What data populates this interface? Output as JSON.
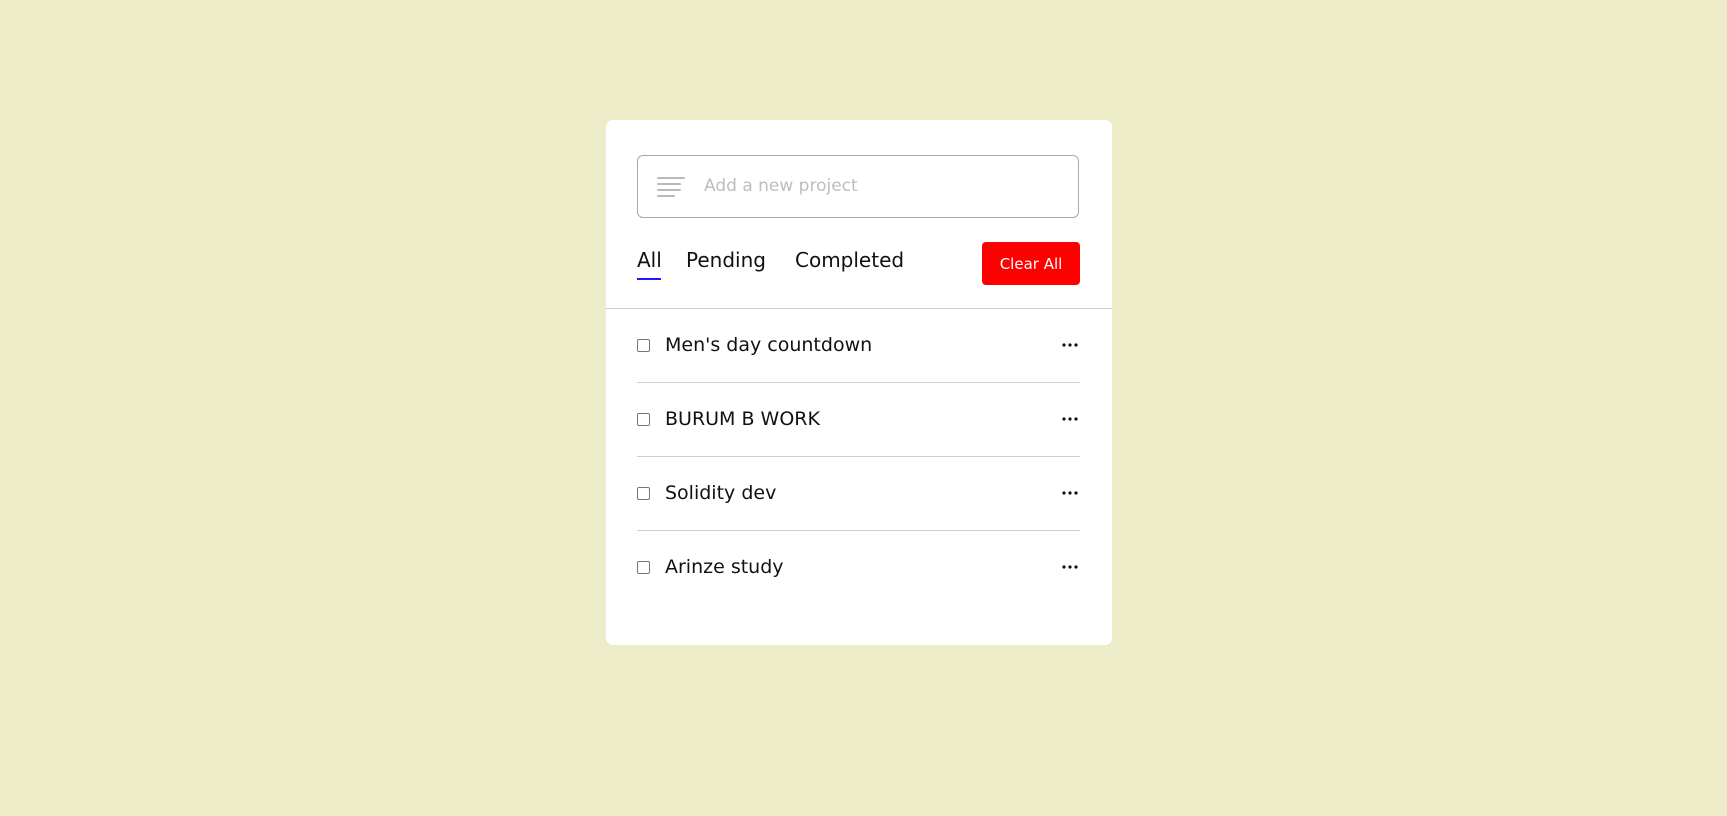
{
  "new_project": {
    "placeholder": "Add a new project",
    "value": "",
    "icon": "text-lines-icon"
  },
  "filters": {
    "tabs": [
      {
        "label": "All",
        "active": true
      },
      {
        "label": "Pending",
        "active": false
      },
      {
        "label": "Completed",
        "active": false
      }
    ],
    "clear_label": "Clear All"
  },
  "tasks": [
    {
      "label": "Men's day countdown",
      "checked": false
    },
    {
      "label": "BURUM B WORK",
      "checked": false
    },
    {
      "label": "Solidity dev",
      "checked": false
    },
    {
      "label": "Arinze study",
      "checked": false
    }
  ],
  "colors": {
    "background": "#ececc9",
    "card": "#ffffff",
    "clear_button": "#ff0000",
    "active_tab_underline": "#1a1aff"
  }
}
